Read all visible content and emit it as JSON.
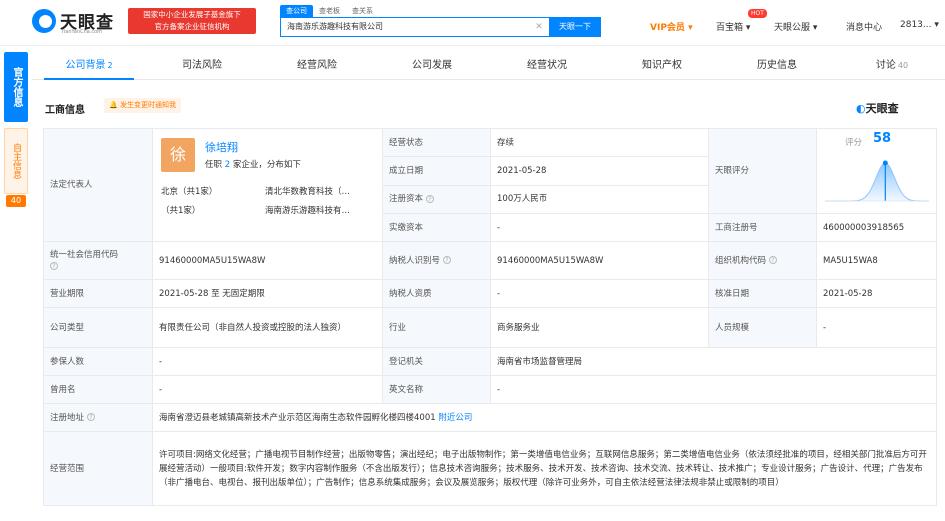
{
  "header": {
    "logo_text": "天眼查",
    "logo_sub": "TianYanCha.com",
    "slogan_line1": "国家中小企业发展子基金旗下",
    "slogan_line2": "官方备案企业征信机构",
    "search_tabs": [
      "查公司",
      "查老板",
      "查关系"
    ],
    "search_value": "海南游乐游趣科技有限公司",
    "search_button": "天眼一下",
    "vip": "VIP会员",
    "baibao": "百宝箱",
    "hot_badge": "HOT",
    "service": "天眼公服",
    "messages": "消息中心",
    "user": "2813..."
  },
  "side_badges": {
    "official": "官方信息",
    "self": "自主信息",
    "self_count": "40"
  },
  "tabs": [
    {
      "label": "公司背景",
      "count": "2"
    },
    {
      "label": "司法风险",
      "count": ""
    },
    {
      "label": "经营风险",
      "count": ""
    },
    {
      "label": "公司发展",
      "count": ""
    },
    {
      "label": "经营状况",
      "count": ""
    },
    {
      "label": "知识产权",
      "count": ""
    },
    {
      "label": "历史信息",
      "count": ""
    },
    {
      "label": "讨论",
      "count": "40"
    }
  ],
  "section": {
    "title": "工商信息",
    "tip": "发生变更时通知我",
    "brand": "天眼查"
  },
  "rep": {
    "label": "法定代表人",
    "avatar": "徐",
    "name": "徐培翔",
    "sub_prefix": "任职",
    "sub_count": "2",
    "sub_suffix": "家企业，分布如下",
    "region1": "北京（共1家）",
    "company1": "清北华数教育科技（…",
    "region2": "（共1家）",
    "company2": "海南游乐游趣科技有…"
  },
  "fields": {
    "status_label": "经营状态",
    "status_value": "存续",
    "founded_label": "成立日期",
    "founded_value": "2021-05-28",
    "capital_label": "注册资本",
    "capital_value": "100万人民币",
    "paid_label": "实缴资本",
    "paid_value": "-",
    "score_block_label": "天眼评分",
    "score_label": "评分",
    "score_value": "58",
    "reg_no_label": "工商注册号",
    "reg_no_value": "460000003918565",
    "credit_label": "统一社会信用代码",
    "credit_value": "91460000MA5U15WA8W",
    "taxpayer_label": "纳税人识别号",
    "taxpayer_value": "91460000MA5U15WA8W",
    "org_label": "组织机构代码",
    "org_value": "MA5U15WA8",
    "term_label": "营业期限",
    "term_value": "2021-05-28 至 无固定期限",
    "taxq_label": "纳税人资质",
    "taxq_value": "-",
    "approve_label": "核准日期",
    "approve_value": "2021-05-28",
    "type_label": "公司类型",
    "type_value": "有限责任公司（非自然人投资或控股的法人独资）",
    "industry_label": "行业",
    "industry_value": "商务服务业",
    "staff_label": "人员规模",
    "staff_value": "-",
    "insured_label": "参保人数",
    "insured_value": "-",
    "authority_label": "登记机关",
    "authority_value": "海南省市场监督管理局",
    "former_label": "曾用名",
    "former_value": "-",
    "en_label": "英文名称",
    "en_value": "-",
    "address_label": "注册地址",
    "address_value": "海南省澄迈县老城镇高新技术产业示范区海南生态软件园孵化楼四楼4001",
    "address_link": "附近公司",
    "scope_label": "经营范围",
    "scope_value": "许可项目:网络文化经营；广播电视节目制作经营；出版物零售；演出经纪；电子出版物制作；第一类增值电信业务；互联网信息服务；第二类增值电信业务（依法须经批准的项目，经相关部门批准后方可开展经营活动）一般项目:软件开发；数字内容制作服务（不含出版发行）；信息技术咨询服务；技术服务、技术开发、技术咨询、技术交流、技术转让、技术推广；专业设计服务；广告设计、代理；广告发布（非广播电台、电视台、报刊出版单位）；广告制作；信息系统集成服务；会议及展览服务；版权代理（除许可业务外，可自主依法经营法律法规非禁止或限制的项目）"
  },
  "score_chart": {
    "type": "area",
    "score": 58
  }
}
